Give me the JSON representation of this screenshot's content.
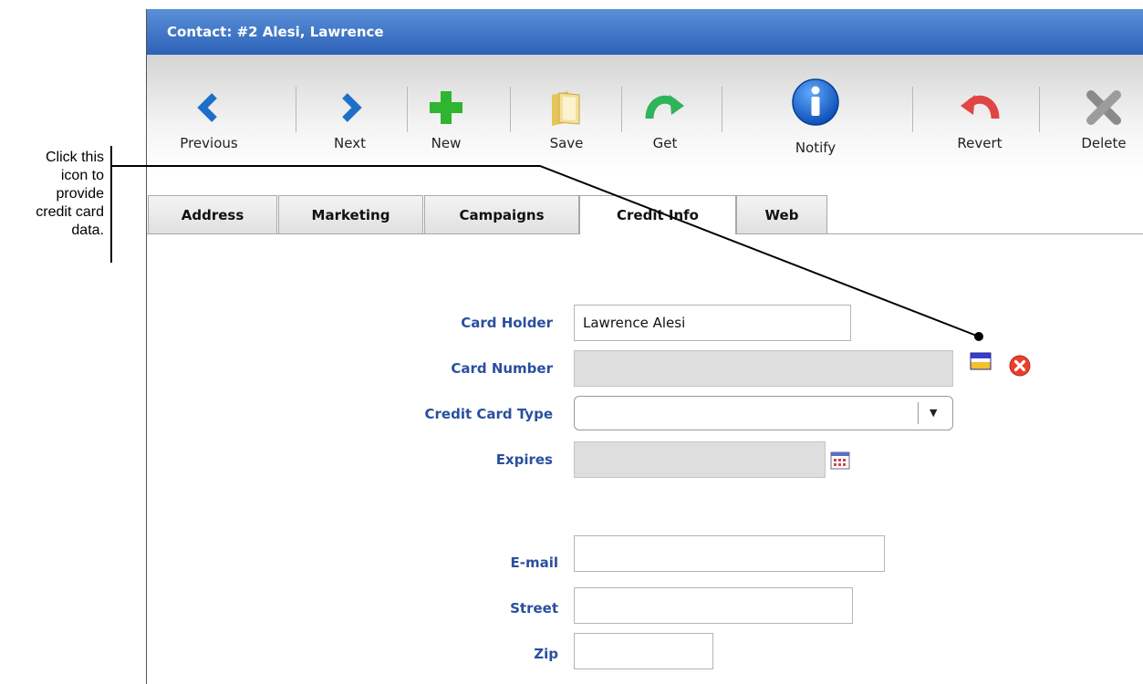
{
  "callout": {
    "lines": [
      "Click this",
      "icon to",
      "provide",
      "credit card",
      "data."
    ]
  },
  "window": {
    "title": "Contact: #2  Alesi, Lawrence"
  },
  "toolbar": {
    "previous": "Previous",
    "next": "Next",
    "new": "New",
    "save": "Save",
    "get": "Get",
    "notify": "Notify",
    "revert": "Revert",
    "delete": "Delete"
  },
  "tabs": [
    "Address",
    "Marketing",
    "Campaigns",
    "Credit Info",
    "Web"
  ],
  "active_tab": "Credit Info",
  "form": {
    "card_holder": {
      "label": "Card Holder",
      "value": "Lawrence Alesi"
    },
    "card_number": {
      "label": "Card Number",
      "value": ""
    },
    "card_type": {
      "label": "Credit Card Type",
      "value": ""
    },
    "expires": {
      "label": "Expires",
      "value": ""
    },
    "email": {
      "label": "E-mail",
      "value": ""
    },
    "street": {
      "label": "Street",
      "value": ""
    },
    "zip": {
      "label": "Zip",
      "value": ""
    }
  },
  "icons": {
    "card_edit": "credit-card-icon",
    "card_clear": "clear-icon",
    "calendar": "calendar-icon"
  },
  "colors": {
    "titlebar": "#2d62b8",
    "label": "#2a4f9e",
    "clear": "#e8402c"
  }
}
